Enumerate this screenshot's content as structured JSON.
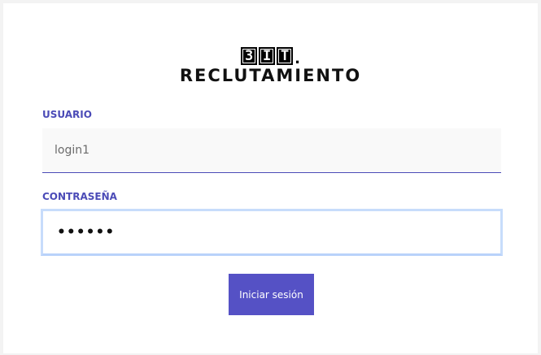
{
  "logo": {
    "chars": [
      "3",
      "I",
      "T"
    ],
    "dot": "."
  },
  "brand": {
    "title": "RECLUTAMIENTO"
  },
  "form": {
    "user_label": "USUARIO",
    "user_value": "login1",
    "password_label": "CONTRASEÑA",
    "password_value": "••••••",
    "submit_label": "Iniciar sesión"
  },
  "colors": {
    "accent": "#5551c5",
    "label": "#4b4bb7",
    "focus_ring": "#c7dcfb"
  }
}
